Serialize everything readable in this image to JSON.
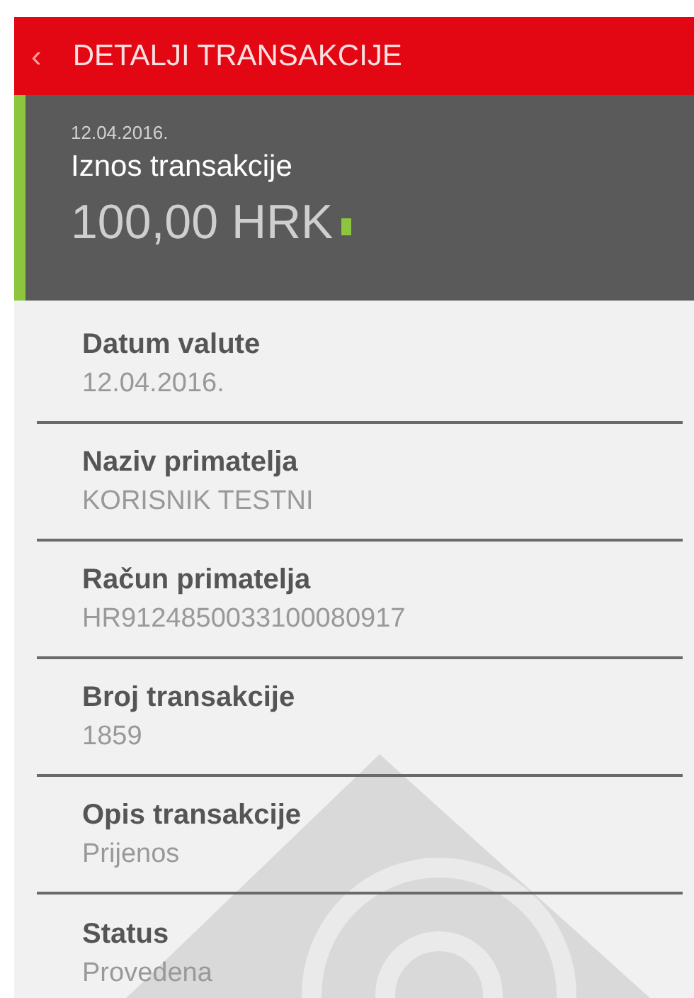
{
  "header": {
    "back_icon": "‹",
    "title": "DETALJI TRANSAKCIJE"
  },
  "summary": {
    "date": "12.04.2016.",
    "label": "Iznos transakcije",
    "amount": "100,00 HRK",
    "color": "#8cc63f"
  },
  "details": [
    {
      "label": "Datum valute",
      "value": "12.04.2016."
    },
    {
      "label": "Naziv primatelja",
      "value": "KORISNIK TESTNI"
    },
    {
      "label": "Račun primatelja",
      "value": "HR9124850033100080917"
    },
    {
      "label": "Broj transakcije",
      "value": "1859"
    },
    {
      "label": "Opis transakcije",
      "value": "Prijenos"
    },
    {
      "label": "Status",
      "value": "Provedena"
    }
  ]
}
